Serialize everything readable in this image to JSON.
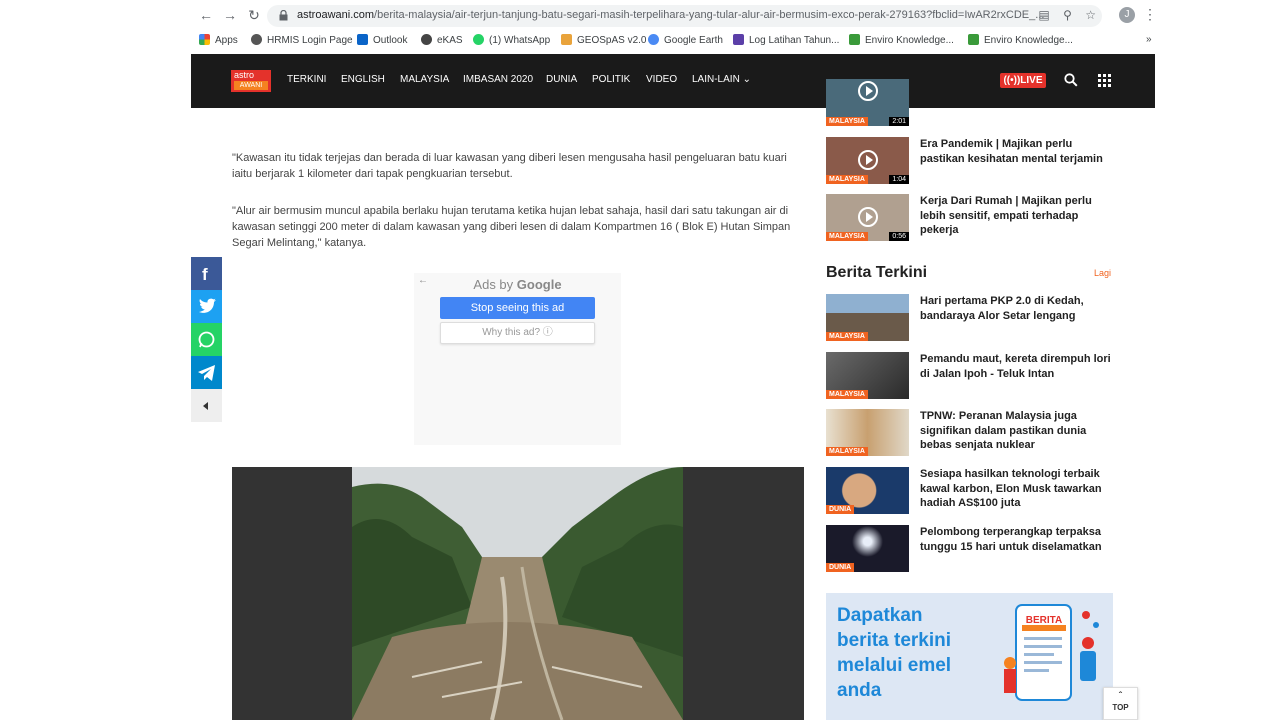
{
  "browser": {
    "url_domain": "astroawani.com",
    "url_path": "/berita-malaysia/air-terjun-tanjung-batu-segari-masih-terpelihara-yang-tular-alur-air-bermusim-exco-perak-279163?fbclid=IwAR2rxCDE_...",
    "avatar_letter": "J",
    "bookmarks": [
      {
        "label": "Apps",
        "color": "#4285f4"
      },
      {
        "label": "HRMIS Login Page",
        "color": "#555555"
      },
      {
        "label": "Outlook",
        "color": "#0a64c8"
      },
      {
        "label": "eKAS",
        "color": "#444444"
      },
      {
        "label": "(1) WhatsApp",
        "color": "#25d366"
      },
      {
        "label": "GEOSpAS v2.0",
        "color": "#e9a33b"
      },
      {
        "label": "Google Earth",
        "color": "#4a8af4"
      },
      {
        "label": "Log Latihan Tahun...",
        "color": "#5b3fa8"
      },
      {
        "label": "Enviro Knowledge...",
        "color": "#3a9a3a"
      },
      {
        "label": "Enviro Knowledge...",
        "color": "#3a9a3a"
      }
    ],
    "more_bookmarks": "»"
  },
  "site": {
    "logo_top": "astro",
    "logo_bottom": "AWANI",
    "nav": [
      "TERKINI",
      "ENGLISH",
      "MALAYSIA",
      "IMBASAN 2020",
      "DUNIA",
      "POLITIK",
      "VIDEO",
      "LAIN-LAIN"
    ],
    "live_label": "LIVE",
    "accent": "#e4322b"
  },
  "article": {
    "paragraphs": [
      "\"Kawasan itu tidak terjejas dan berada di luar kawasan yang diberi lesen mengusaha hasil pengeluaran batu kuari iaitu berjarak 1 kilometer dari tapak pengkuarian tersebut.",
      "\"Alur air bermusim muncul apabila berlaku hujan terutama ketika hujan lebat sahaja, hasil dari satu takungan air di kawasan setinggi 200 meter di dalam kawasan yang diberi lesen di dalam Kompartmen 16 ( Blok E) Hutan Simpan Segari Melintang,\" katanya."
    ]
  },
  "ad": {
    "ads_by": "Ads by",
    "google": "Google",
    "stop_label": "Stop seeing this ad",
    "why_label": "Why this ad?"
  },
  "sidebar": {
    "videos": [
      {
        "title": "",
        "tag": "MALAYSIA",
        "duration": "2:01",
        "color": "#4a6a7a"
      },
      {
        "title": "Era Pandemik | Majikan perlu pastikan kesihatan mental terjamin",
        "tag": "MALAYSIA",
        "duration": "1:04",
        "color": "#8a5a4a"
      },
      {
        "title": "Kerja Dari Rumah | Majikan perlu lebih sensitif, empati terhadap pekerja",
        "tag": "MALAYSIA",
        "duration": "0:56",
        "color": "#b0a090"
      }
    ],
    "section_title": "Berita Terkini",
    "section_more": "Lagi",
    "news": [
      {
        "title": "Hari pertama PKP 2.0 di Kedah, bandaraya Alor Setar lengang",
        "tag": "MALAYSIA",
        "color": "#7a8fa8"
      },
      {
        "title": "Pemandu maut, kereta dirempuh lori di Jalan Ipoh - Teluk Intan",
        "tag": "MALAYSIA",
        "color": "#5a5a5a"
      },
      {
        "title": "TPNW: Peranan Malaysia juga signifikan dalam pastikan dunia bebas senjata nuklear",
        "tag": "MALAYSIA",
        "color": "#c8a070"
      },
      {
        "title": "Sesiapa hasilkan teknologi terbaik kawal karbon, Elon Musk tawarkan hadiah AS$100 juta",
        "tag": "DUNIA",
        "color": "#1a3a6a"
      },
      {
        "title": "Pelombong terperangkap terpaksa tunggu 15 hari untuk diselamatkan",
        "tag": "DUNIA",
        "color": "#1a1a2a"
      }
    ],
    "promo_text": "Dapatkan berita terkini melalui emel anda",
    "promo_badge": "BERITA"
  },
  "top_button": "TOP"
}
